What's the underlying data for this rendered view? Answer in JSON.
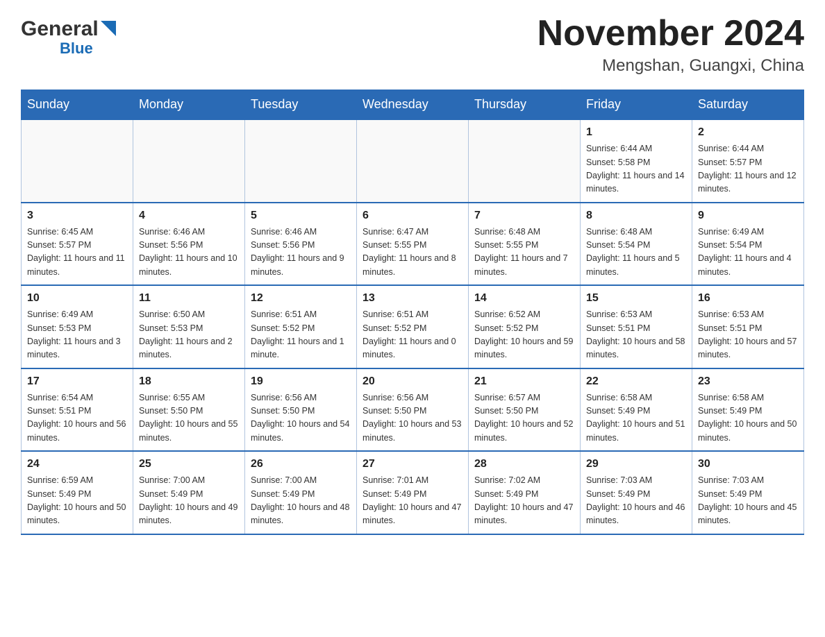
{
  "header": {
    "logo_general": "General",
    "logo_blue": "Blue",
    "month_title": "November 2024",
    "location": "Mengshan, Guangxi, China"
  },
  "days_of_week": [
    "Sunday",
    "Monday",
    "Tuesday",
    "Wednesday",
    "Thursday",
    "Friday",
    "Saturday"
  ],
  "weeks": [
    [
      {
        "day": "",
        "info": ""
      },
      {
        "day": "",
        "info": ""
      },
      {
        "day": "",
        "info": ""
      },
      {
        "day": "",
        "info": ""
      },
      {
        "day": "",
        "info": ""
      },
      {
        "day": "1",
        "info": "Sunrise: 6:44 AM\nSunset: 5:58 PM\nDaylight: 11 hours and 14 minutes."
      },
      {
        "day": "2",
        "info": "Sunrise: 6:44 AM\nSunset: 5:57 PM\nDaylight: 11 hours and 12 minutes."
      }
    ],
    [
      {
        "day": "3",
        "info": "Sunrise: 6:45 AM\nSunset: 5:57 PM\nDaylight: 11 hours and 11 minutes."
      },
      {
        "day": "4",
        "info": "Sunrise: 6:46 AM\nSunset: 5:56 PM\nDaylight: 11 hours and 10 minutes."
      },
      {
        "day": "5",
        "info": "Sunrise: 6:46 AM\nSunset: 5:56 PM\nDaylight: 11 hours and 9 minutes."
      },
      {
        "day": "6",
        "info": "Sunrise: 6:47 AM\nSunset: 5:55 PM\nDaylight: 11 hours and 8 minutes."
      },
      {
        "day": "7",
        "info": "Sunrise: 6:48 AM\nSunset: 5:55 PM\nDaylight: 11 hours and 7 minutes."
      },
      {
        "day": "8",
        "info": "Sunrise: 6:48 AM\nSunset: 5:54 PM\nDaylight: 11 hours and 5 minutes."
      },
      {
        "day": "9",
        "info": "Sunrise: 6:49 AM\nSunset: 5:54 PM\nDaylight: 11 hours and 4 minutes."
      }
    ],
    [
      {
        "day": "10",
        "info": "Sunrise: 6:49 AM\nSunset: 5:53 PM\nDaylight: 11 hours and 3 minutes."
      },
      {
        "day": "11",
        "info": "Sunrise: 6:50 AM\nSunset: 5:53 PM\nDaylight: 11 hours and 2 minutes."
      },
      {
        "day": "12",
        "info": "Sunrise: 6:51 AM\nSunset: 5:52 PM\nDaylight: 11 hours and 1 minute."
      },
      {
        "day": "13",
        "info": "Sunrise: 6:51 AM\nSunset: 5:52 PM\nDaylight: 11 hours and 0 minutes."
      },
      {
        "day": "14",
        "info": "Sunrise: 6:52 AM\nSunset: 5:52 PM\nDaylight: 10 hours and 59 minutes."
      },
      {
        "day": "15",
        "info": "Sunrise: 6:53 AM\nSunset: 5:51 PM\nDaylight: 10 hours and 58 minutes."
      },
      {
        "day": "16",
        "info": "Sunrise: 6:53 AM\nSunset: 5:51 PM\nDaylight: 10 hours and 57 minutes."
      }
    ],
    [
      {
        "day": "17",
        "info": "Sunrise: 6:54 AM\nSunset: 5:51 PM\nDaylight: 10 hours and 56 minutes."
      },
      {
        "day": "18",
        "info": "Sunrise: 6:55 AM\nSunset: 5:50 PM\nDaylight: 10 hours and 55 minutes."
      },
      {
        "day": "19",
        "info": "Sunrise: 6:56 AM\nSunset: 5:50 PM\nDaylight: 10 hours and 54 minutes."
      },
      {
        "day": "20",
        "info": "Sunrise: 6:56 AM\nSunset: 5:50 PM\nDaylight: 10 hours and 53 minutes."
      },
      {
        "day": "21",
        "info": "Sunrise: 6:57 AM\nSunset: 5:50 PM\nDaylight: 10 hours and 52 minutes."
      },
      {
        "day": "22",
        "info": "Sunrise: 6:58 AM\nSunset: 5:49 PM\nDaylight: 10 hours and 51 minutes."
      },
      {
        "day": "23",
        "info": "Sunrise: 6:58 AM\nSunset: 5:49 PM\nDaylight: 10 hours and 50 minutes."
      }
    ],
    [
      {
        "day": "24",
        "info": "Sunrise: 6:59 AM\nSunset: 5:49 PM\nDaylight: 10 hours and 50 minutes."
      },
      {
        "day": "25",
        "info": "Sunrise: 7:00 AM\nSunset: 5:49 PM\nDaylight: 10 hours and 49 minutes."
      },
      {
        "day": "26",
        "info": "Sunrise: 7:00 AM\nSunset: 5:49 PM\nDaylight: 10 hours and 48 minutes."
      },
      {
        "day": "27",
        "info": "Sunrise: 7:01 AM\nSunset: 5:49 PM\nDaylight: 10 hours and 47 minutes."
      },
      {
        "day": "28",
        "info": "Sunrise: 7:02 AM\nSunset: 5:49 PM\nDaylight: 10 hours and 47 minutes."
      },
      {
        "day": "29",
        "info": "Sunrise: 7:03 AM\nSunset: 5:49 PM\nDaylight: 10 hours and 46 minutes."
      },
      {
        "day": "30",
        "info": "Sunrise: 7:03 AM\nSunset: 5:49 PM\nDaylight: 10 hours and 45 minutes."
      }
    ]
  ]
}
